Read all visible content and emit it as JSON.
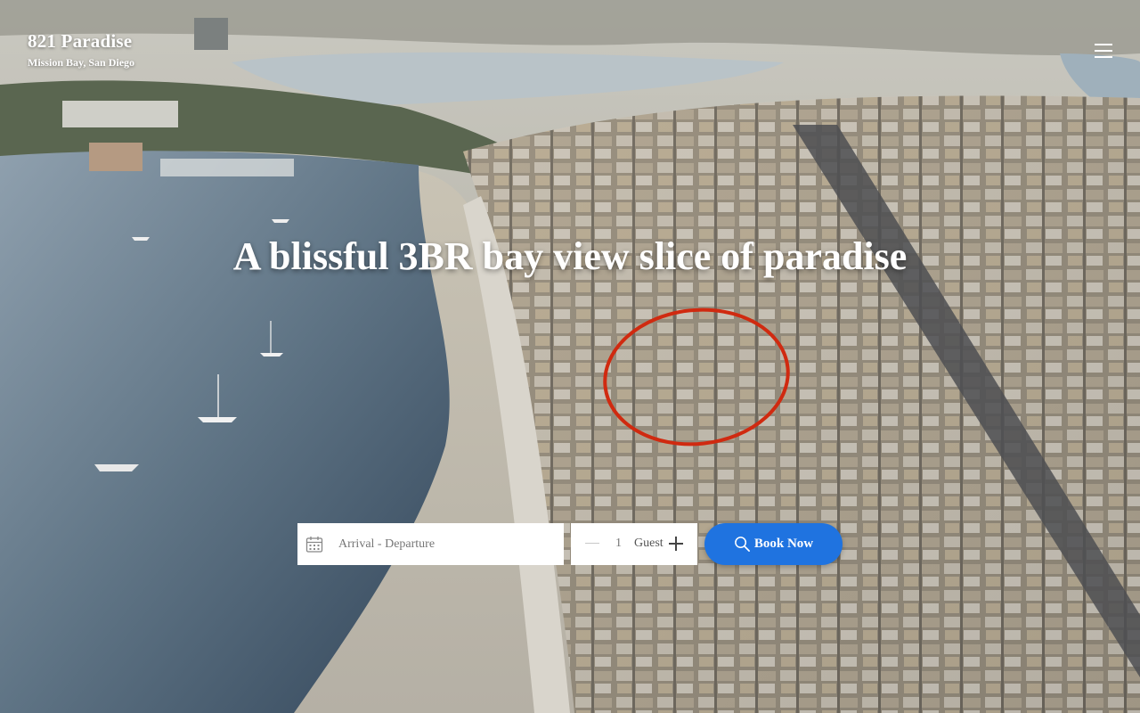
{
  "brand": {
    "title": "821 Paradise",
    "subtitle": "Mission Bay, San Diego"
  },
  "hero": {
    "headline": "A blissful 3BR bay view slice of paradise",
    "background": "aerial photo of Mission Bay beach with houses, highlighted home circled in red"
  },
  "nav": {
    "menu_icon": "hamburger-menu-icon"
  },
  "booking": {
    "dates_placeholder": "Arrival - Departure",
    "calendar_icon": "calendar-icon",
    "guest_count": "1",
    "guest_label": "Guest",
    "book_label": "Book Now",
    "search_icon": "search-icon"
  },
  "colors": {
    "accent": "#1f73e0",
    "highlight_circle": "#d02a10",
    "text_on_image": "#ffffff"
  }
}
